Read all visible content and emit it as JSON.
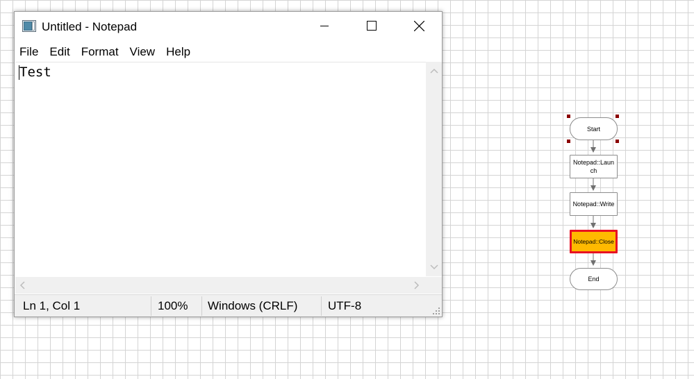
{
  "notepad": {
    "title": "Untitled - Notepad",
    "menu": [
      "File",
      "Edit",
      "Format",
      "View",
      "Help"
    ],
    "content": "Test",
    "status": {
      "position": "Ln 1, Col 1",
      "zoom": "100%",
      "line_ending": "Windows (CRLF)",
      "encoding": "UTF-8"
    },
    "icons": {
      "app": "notepad-icon",
      "minimize": "minimize-icon",
      "maximize": "maximize-icon",
      "close": "close-icon"
    }
  },
  "flowchart": {
    "nodes": [
      {
        "label": "Start",
        "kind": "terminal",
        "selected": true,
        "active": false
      },
      {
        "label": "Notepad::Launch",
        "kind": "action",
        "selected": false,
        "active": false
      },
      {
        "label": "Notepad::Write",
        "kind": "action",
        "selected": false,
        "active": false
      },
      {
        "label": "Notepad::Close",
        "kind": "action",
        "selected": false,
        "active": true
      },
      {
        "label": "End",
        "kind": "terminal",
        "selected": false,
        "active": false
      }
    ],
    "colors": {
      "active_fill": "#FFB900",
      "active_border": "#E81123",
      "selection_handle": "#8B0000",
      "connector": "#707070"
    }
  }
}
